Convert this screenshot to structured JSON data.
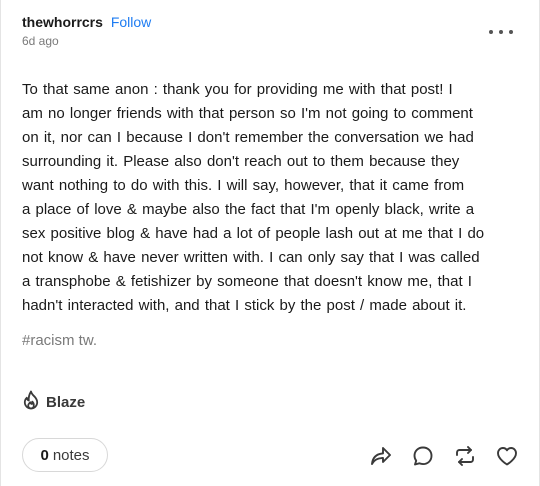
{
  "post": {
    "blog_name": "thewhorrcrs",
    "follow_label": "Follow",
    "timestamp": "6d ago",
    "more_icon": "ellipsis-icon",
    "body_lines": [
      "To that same anon  :  thank you for providing me with that post!  I",
      "am no longer friends with that person so I'm not going to comment",
      "on it,  nor can I because I don't remember the conversation we had",
      "surrounding it.   Please also don't reach out to them because they",
      "want nothing to do with this.   I will say,  however,  that it came from",
      "a place of love   &   maybe also the fact that I'm openly black,  write a",
      "sex positive blog   &   have had a lot of people lash out at me that I do",
      "not know   &   have never written with.   I can only say that I was called",
      "a transphobe   &   fetishizer by someone that doesn't know me,  that I",
      "hadn't interacted with,  and that I stick by the post / made about it."
    ],
    "tags": [
      "#racism tw."
    ],
    "blaze_label": "Blaze",
    "notes_count": "0",
    "notes_label": "notes",
    "action_icons": [
      "share-icon",
      "reply-icon",
      "reblog-icon",
      "like-icon"
    ]
  },
  "colors": {
    "accent": "#1e7cf2",
    "text": "#1a1a1a",
    "muted": "#7a7a7a"
  }
}
